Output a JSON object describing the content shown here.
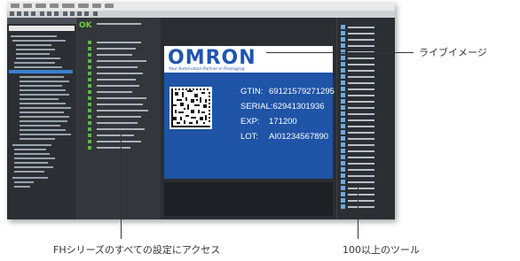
{
  "viewer": {
    "brand": "OMRON",
    "tagline": "Your Automation Partner in Packaging",
    "fields": [
      {
        "label": "GTIN:",
        "value": "69121579271295"
      },
      {
        "label": "SERIAL:",
        "value": "62941301936"
      },
      {
        "label": "EXP:",
        "value": "171200"
      },
      {
        "label": "LOT:",
        "value": "AI01234567890"
      }
    ]
  },
  "status": {
    "ok_label": "OK"
  },
  "callouts": {
    "live_image": "ライブイメージ",
    "all_settings": "FHシリーズのすべての設定にアクセス",
    "tools": "100以上のツール"
  },
  "colors": {
    "brand_blue": "#1f55b0",
    "image_bg": "#1f54a6",
    "ok_green": "#6ccf3b"
  }
}
